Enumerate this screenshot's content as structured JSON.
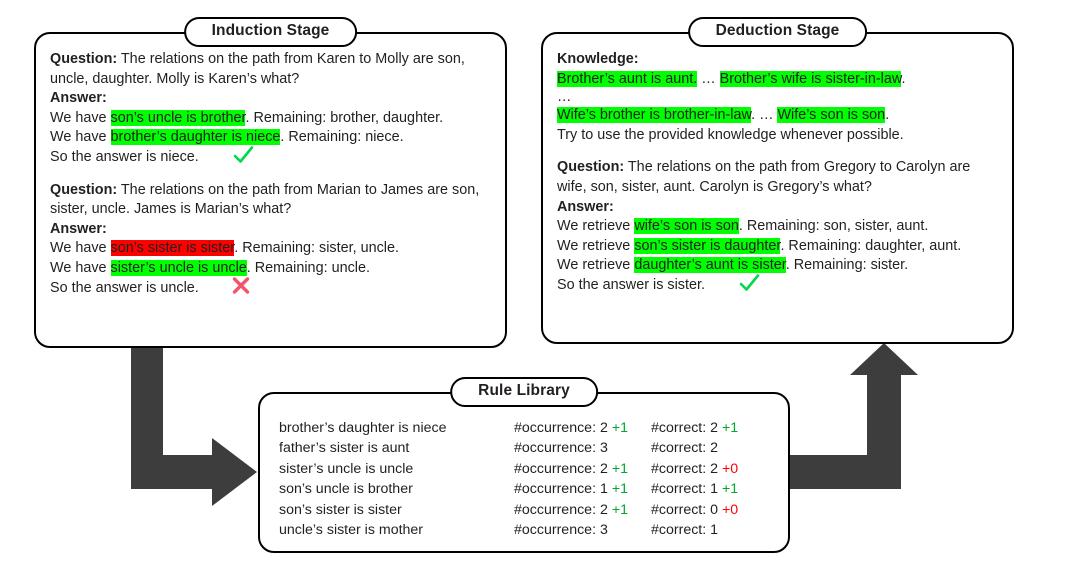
{
  "induction": {
    "title": "Induction Stage",
    "examples": [
      {
        "question_label": "Question:",
        "question_text": " The relations on the path from Karen to Molly are son, uncle, daughter. Molly is Karen’s what?",
        "answer_label": "Answer:",
        "steps": [
          {
            "prefix": "We have ",
            "rule": "son’s uncle is brother",
            "rule_style": "green",
            "suffix": ". Remaining: brother, daughter."
          },
          {
            "prefix": "We have ",
            "rule": "brother’s daughter is niece",
            "rule_style": "green",
            "suffix": ". Remaining: niece."
          }
        ],
        "conclusion": "So the answer is niece.",
        "verdict": "check"
      },
      {
        "question_label": "Question:",
        "question_text": " The relations on the path from Marian to James are son, sister, uncle. James is Marian’s what?",
        "answer_label": "Answer:",
        "steps": [
          {
            "prefix": "We have ",
            "rule": "son’s sister is sister",
            "rule_style": "red",
            "suffix": ". Remaining: sister, uncle."
          },
          {
            "prefix": "We have ",
            "rule": "sister’s uncle is uncle",
            "rule_style": "green",
            "suffix": ". Remaining: uncle."
          }
        ],
        "conclusion": "So the answer is uncle.",
        "verdict": "cross"
      }
    ]
  },
  "deduction": {
    "title": "Deduction Stage",
    "knowledge_label": "Knowledge:",
    "knowledge_lines": [
      {
        "segments": [
          {
            "text": "Brother’s aunt is aunt.",
            "style": "green"
          },
          {
            "text": " … ",
            "style": "plain"
          },
          {
            "text": "Brother’s wife is sister-in-law",
            "style": "green"
          },
          {
            "text": ".",
            "style": "plain"
          }
        ]
      },
      {
        "segments": [
          {
            "text": "…",
            "style": "plain"
          }
        ]
      },
      {
        "segments": [
          {
            "text": "Wife’s brother is brother-in-law",
            "style": "green"
          },
          {
            "text": ". … ",
            "style": "plain"
          },
          {
            "text": "Wife’s son is son",
            "style": "green"
          },
          {
            "text": ".",
            "style": "plain"
          }
        ]
      },
      {
        "segments": [
          {
            "text": "Try to use the provided knowledge whenever possible.",
            "style": "plain"
          }
        ]
      }
    ],
    "question_label": "Question:",
    "question_text": " The relations on the path from Gregory to Carolyn are wife, son, sister, aunt. Carolyn is Gregory’s what?",
    "answer_label": "Answer:",
    "steps": [
      {
        "prefix": "We retrieve ",
        "rule": "wife’s son is son",
        "rule_style": "green",
        "suffix": ". Remaining: son, sister, aunt."
      },
      {
        "prefix": "We retrieve ",
        "rule": "son’s sister is daughter",
        "rule_style": "green",
        "suffix": ". Remaining: daughter, aunt."
      },
      {
        "prefix": "We retrieve ",
        "rule": "daughter’s aunt is sister",
        "rule_style": "green",
        "suffix": ". Remaining: sister."
      }
    ],
    "conclusion": "So the answer is sister.",
    "verdict": "check"
  },
  "rule_library": {
    "title": "Rule Library",
    "occurrence_label": "#occurrence: ",
    "correct_label": "#correct: ",
    "rows": [
      {
        "rule": "brother’s daughter is niece",
        "occurrence": "2",
        "occurrence_delta": "+1",
        "occurrence_delta_style": "pos",
        "correct": "2",
        "correct_delta": "+1",
        "correct_delta_style": "pos"
      },
      {
        "rule": "father’s sister is aunt",
        "occurrence": "3",
        "occurrence_delta": "",
        "occurrence_delta_style": "none",
        "correct": "2",
        "correct_delta": "",
        "correct_delta_style": "none"
      },
      {
        "rule": "sister’s uncle is uncle",
        "occurrence": "2",
        "occurrence_delta": "+1",
        "occurrence_delta_style": "pos",
        "correct": "2",
        "correct_delta": "+0",
        "correct_delta_style": "neg"
      },
      {
        "rule": "son’s uncle is brother",
        "occurrence": "1",
        "occurrence_delta": "+1",
        "occurrence_delta_style": "pos",
        "correct": "1",
        "correct_delta": "+1",
        "correct_delta_style": "pos"
      },
      {
        "rule": "son’s sister is sister",
        "occurrence": "2",
        "occurrence_delta": "+1",
        "occurrence_delta_style": "pos",
        "correct": "0",
        "correct_delta": "+0",
        "correct_delta_style": "neg"
      },
      {
        "rule": "uncle’s sister is mother",
        "occurrence": "3",
        "occurrence_delta": "",
        "occurrence_delta_style": "none",
        "correct": "1",
        "correct_delta": "",
        "correct_delta_style": "none"
      }
    ]
  },
  "colors": {
    "highlight_green": "#00ff00",
    "highlight_red": "#ff0000",
    "delta_positive": "#00a82d",
    "delta_negative": "#ff0000",
    "check_mark": "#00d94a",
    "cross_mark": "#f0556b",
    "arrow": "#3d3d3d"
  }
}
